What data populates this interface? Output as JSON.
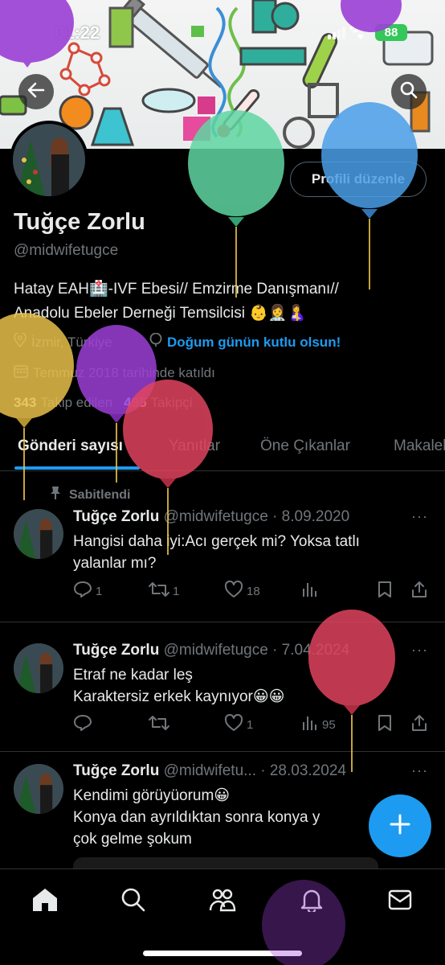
{
  "status_bar": {
    "time": "01:22",
    "battery": "88"
  },
  "header": {
    "back_icon": "arrow-left-icon",
    "search_icon": "search-icon"
  },
  "profile": {
    "name": "Tuğçe Zorlu",
    "handle": "@midwifetugce",
    "edit_button": "Profili düzenle",
    "bio_line1": "Hatay EAH🏥-IVF Ebesi// Emzirme Danışmanı//",
    "bio_line2": "Anadolu Ebeler Derneği Temsilcisi 👶👩‍⚕️🤱",
    "location": "İzmir, Türkiye",
    "birthday": "Doğum günün kutlu olsun!",
    "joined": "Temmuz 2018 tarihinde katıldı",
    "following_count": "343",
    "following_label": "Takip edilen",
    "followers_count": "495",
    "followers_label": "Takipçi"
  },
  "tabs": [
    {
      "label": "Gönderi sayısı",
      "active": true
    },
    {
      "label": "Yanıtlar"
    },
    {
      "label": "Öne Çıkanlar"
    },
    {
      "label": "Makaleler"
    }
  ],
  "pinned_label": "Sabitlendi",
  "posts": [
    {
      "name": "Tuğçe Zorlu",
      "handle": "@midwifetugce",
      "date": "· 8.09.2020",
      "line1": "Hangisi daha iyi:Acı gerçek mi? Yoksa tatlı",
      "line2": "yalanlar mı?",
      "replies": "1",
      "reposts": "1",
      "likes": "18",
      "views": ""
    },
    {
      "name": "Tuğçe Zorlu",
      "handle": "@midwifetugce",
      "date": "· 7.04.2024",
      "line1": "Etraf ne kadar leş",
      "line2": "Karaktersiz erkek kaynıyor😀😀",
      "replies": "",
      "reposts": "",
      "likes": "1",
      "views": "95"
    },
    {
      "name": "Tuğçe Zorlu",
      "handle": "@midwifetu...",
      "date": "· 28.03.2024",
      "line1": "Kendimi görüyüorum😀",
      "line2": "Konya dan ayrıldıktan sonra konya y",
      "line3": "çok gelme şokum"
    }
  ],
  "more_label": "···",
  "bottom_nav": [
    {
      "icon": "home-icon"
    },
    {
      "icon": "search-icon"
    },
    {
      "icon": "communities-icon"
    },
    {
      "icon": "bell-icon"
    },
    {
      "icon": "mail-icon"
    }
  ],
  "colors": {
    "accent": "#1d9bf0",
    "background": "#000000",
    "muted": "#71767b",
    "text": "#e7e9ea"
  }
}
